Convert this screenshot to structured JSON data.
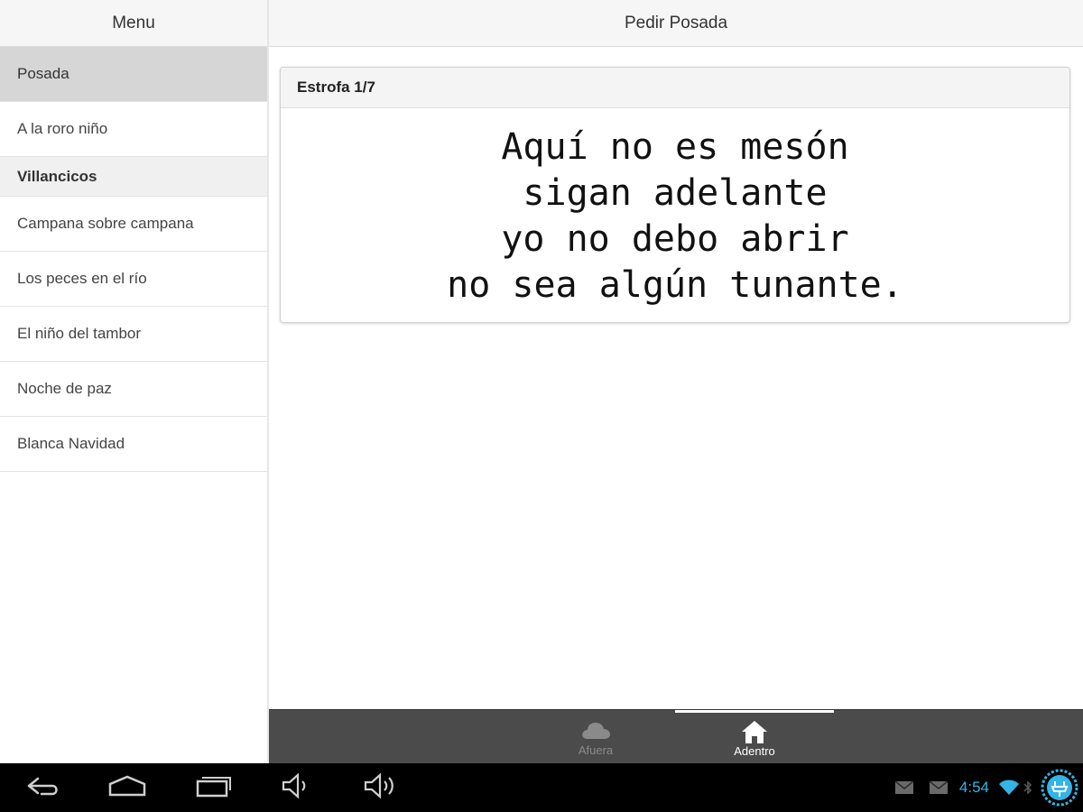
{
  "sidebar": {
    "header": "Menu",
    "items": [
      {
        "label": "Posada",
        "type": "item",
        "active": true
      },
      {
        "label": "A la roro niño",
        "type": "item",
        "active": false
      },
      {
        "label": "Villancicos",
        "type": "divider"
      },
      {
        "label": "Campana sobre campana",
        "type": "item",
        "active": false
      },
      {
        "label": "Los peces en el río",
        "type": "item",
        "active": false
      },
      {
        "label": "El niño del tambor",
        "type": "item",
        "active": false
      },
      {
        "label": "Noche de paz",
        "type": "item",
        "active": false
      },
      {
        "label": "Blanca Navidad",
        "type": "item",
        "active": false
      }
    ]
  },
  "main": {
    "title": "Pedir Posada",
    "card": {
      "title": "Estrofa 1/7",
      "lines": [
        "Aquí no es mesón",
        "sigan adelante",
        "yo no debo abrir",
        "no sea algún tunante."
      ]
    }
  },
  "tabs": [
    {
      "label": "Afuera",
      "icon": "cloud-icon",
      "active": false
    },
    {
      "label": "Adentro",
      "icon": "home-icon",
      "active": true
    }
  ],
  "system_bar": {
    "time": "4:54",
    "buttons": [
      "back-icon",
      "home-icon",
      "recent-apps-icon",
      "volume-down-icon",
      "volume-up-icon"
    ],
    "status_icons": [
      "mail-icon",
      "mail-icon",
      "wifi-icon",
      "bluetooth-icon",
      "battery-charging-icon"
    ],
    "accent_color": "#33b5e5"
  }
}
